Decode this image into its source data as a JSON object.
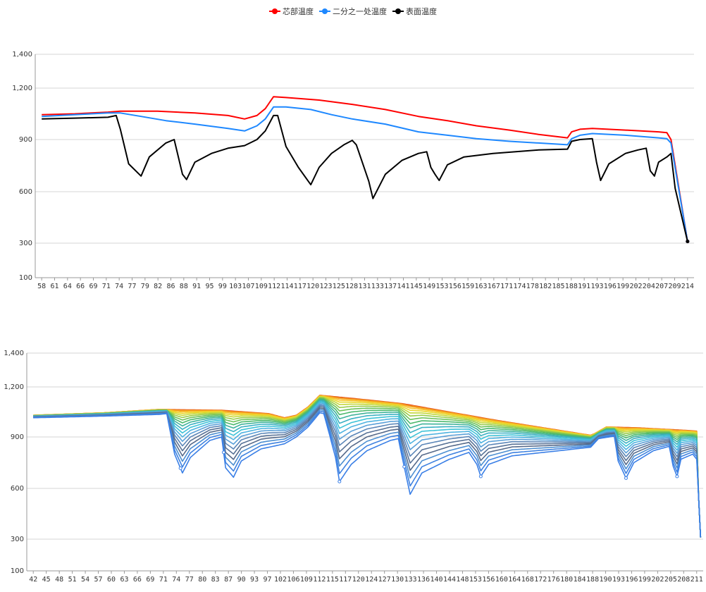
{
  "legend": [
    {
      "label": "芯部温度",
      "color": "#ff0000"
    },
    {
      "label": "二分之一处温度",
      "color": "#1e88ff"
    },
    {
      "label": "表面温度",
      "color": "#000000"
    }
  ],
  "chart_data": [
    {
      "type": "line",
      "title": "",
      "xlabel": "",
      "ylabel": "",
      "ylim": [
        100,
        1400
      ],
      "yticks": [
        100,
        300,
        600,
        900,
        1200,
        1400
      ],
      "ytick_labels": [
        "100",
        "300",
        "600",
        "900",
        "1,200",
        "1,400"
      ],
      "xticks": [
        "58",
        "61",
        "64",
        "66",
        "69",
        "71",
        "74",
        "77",
        "79",
        "82",
        "86",
        "88",
        "91",
        "95",
        "99",
        "103",
        "107",
        "109",
        "112",
        "114",
        "117",
        "120",
        "123",
        "125",
        "128",
        "131",
        "133",
        "137",
        "141",
        "145",
        "149",
        "153",
        "156",
        "159",
        "163",
        "167",
        "171",
        "174",
        "178",
        "182",
        "185",
        "188",
        "191",
        "193",
        "196",
        "199",
        "202",
        "204",
        "207",
        "209",
        "214"
      ],
      "grid": "horizontal",
      "legend_position": "top-center",
      "series": [
        {
          "name": "芯部温度",
          "color": "#ff0000",
          "points": [
            [
              58,
              1045
            ],
            [
              66,
              1050
            ],
            [
              74,
              1060
            ],
            [
              77,
              1065
            ],
            [
              86,
              1065
            ],
            [
              95,
              1055
            ],
            [
              103,
              1040
            ],
            [
              107,
              1020
            ],
            [
              110,
              1040
            ],
            [
              112,
              1080
            ],
            [
              114,
              1150
            ],
            [
              117,
              1145
            ],
            [
              125,
              1130
            ],
            [
              133,
              1105
            ],
            [
              141,
              1075
            ],
            [
              149,
              1035
            ],
            [
              156,
              1010
            ],
            [
              163,
              980
            ],
            [
              171,
              955
            ],
            [
              178,
              930
            ],
            [
              185,
              910
            ],
            [
              186,
              945
            ],
            [
              188,
              960
            ],
            [
              191,
              965
            ],
            [
              199,
              955
            ],
            [
              207,
              945
            ],
            [
              209,
              940
            ],
            [
              210,
              900
            ],
            [
              214,
              310
            ]
          ]
        },
        {
          "name": "二分之一处温度",
          "color": "#1e88ff",
          "points": [
            [
              58,
              1035
            ],
            [
              66,
              1045
            ],
            [
              74,
              1055
            ],
            [
              77,
              1055
            ],
            [
              82,
              1035
            ],
            [
              88,
              1010
            ],
            [
              95,
              990
            ],
            [
              103,
              965
            ],
            [
              107,
              950
            ],
            [
              110,
              980
            ],
            [
              112,
              1020
            ],
            [
              114,
              1090
            ],
            [
              117,
              1090
            ],
            [
              123,
              1075
            ],
            [
              128,
              1045
            ],
            [
              133,
              1020
            ],
            [
              141,
              990
            ],
            [
              149,
              945
            ],
            [
              156,
              925
            ],
            [
              163,
              905
            ],
            [
              171,
              890
            ],
            [
              178,
              880
            ],
            [
              185,
              870
            ],
            [
              186,
              905
            ],
            [
              188,
              925
            ],
            [
              191,
              935
            ],
            [
              199,
              925
            ],
            [
              207,
              910
            ],
            [
              209,
              905
            ],
            [
              210,
              880
            ],
            [
              214,
              310
            ]
          ]
        },
        {
          "name": "表面温度",
          "color": "#000000",
          "points": [
            [
              58,
              1020
            ],
            [
              66,
              1025
            ],
            [
              74,
              1030
            ],
            [
              76,
              1040
            ],
            [
              77,
              960
            ],
            [
              79,
              760
            ],
            [
              82,
              690
            ],
            [
              84,
              800
            ],
            [
              88,
              880
            ],
            [
              90,
              900
            ],
            [
              92,
              700
            ],
            [
              93,
              670
            ],
            [
              95,
              770
            ],
            [
              99,
              820
            ],
            [
              103,
              850
            ],
            [
              107,
              865
            ],
            [
              110,
              900
            ],
            [
              112,
              950
            ],
            [
              114,
              1040
            ],
            [
              115,
              1040
            ],
            [
              117,
              860
            ],
            [
              120,
              740
            ],
            [
              123,
              640
            ],
            [
              125,
              740
            ],
            [
              128,
              820
            ],
            [
              131,
              870
            ],
            [
              133,
              895
            ],
            [
              134,
              870
            ],
            [
              137,
              660
            ],
            [
              138,
              560
            ],
            [
              141,
              700
            ],
            [
              145,
              780
            ],
            [
              149,
              820
            ],
            [
              151,
              830
            ],
            [
              152,
              740
            ],
            [
              153,
              700
            ],
            [
              154,
              665
            ],
            [
              156,
              755
            ],
            [
              160,
              800
            ],
            [
              167,
              820
            ],
            [
              178,
              840
            ],
            [
              185,
              845
            ],
            [
              186,
              890
            ],
            [
              188,
              900
            ],
            [
              191,
              905
            ],
            [
              192,
              770
            ],
            [
              193,
              665
            ],
            [
              195,
              760
            ],
            [
              199,
              820
            ],
            [
              202,
              840
            ],
            [
              204,
              850
            ],
            [
              205,
              720
            ],
            [
              206,
              690
            ],
            [
              207,
              770
            ],
            [
              209,
              800
            ],
            [
              210,
              820
            ],
            [
              211,
              620
            ],
            [
              214,
              310
            ]
          ]
        }
      ]
    },
    {
      "type": "line",
      "title": "",
      "xlabel": "",
      "ylabel": "",
      "ylim": [
        100,
        1400
      ],
      "yticks": [
        100,
        300,
        600,
        900,
        1200,
        1400
      ],
      "ytick_labels": [
        "100",
        "300",
        "600",
        "900",
        "1,200",
        "1,400"
      ],
      "xticks": [
        "42",
        "45",
        "48",
        "51",
        "54",
        "57",
        "60",
        "63",
        "66",
        "69",
        "71",
        "74",
        "77",
        "80",
        "83",
        "87",
        "90",
        "93",
        "97",
        "102",
        "106",
        "109",
        "112",
        "115",
        "117",
        "120",
        "124",
        "127",
        "130",
        "133",
        "136",
        "140",
        "144",
        "148",
        "153",
        "156",
        "160",
        "164",
        "168",
        "172",
        "176",
        "180",
        "184",
        "188",
        "190",
        "193",
        "196",
        "199",
        "202",
        "205",
        "208",
        "211"
      ],
      "grid": "horizontal",
      "series_count": 20,
      "series_colors": [
        "#e34a1f",
        "#ef7a1a",
        "#f5a623",
        "#f7c52b",
        "#e8d82a",
        "#c4d83a",
        "#99cc4a",
        "#6ec25a",
        "#4bb96d",
        "#3fb39a",
        "#3ab0c3",
        "#3ec3d7",
        "#4fb3e0",
        "#5aa0d8",
        "#5b86b8",
        "#587296",
        "#566a8a",
        "#4d8fd1",
        "#3f82e0",
        "#3a7fe6"
      ],
      "envelope_top": [
        [
          42,
          1030
        ],
        [
          60,
          1045
        ],
        [
          74,
          1065
        ],
        [
          90,
          1060
        ],
        [
          102,
          1040
        ],
        [
          106,
          1015
        ],
        [
          109,
          1030
        ],
        [
          112,
          1080
        ],
        [
          115,
          1150
        ],
        [
          124,
          1130
        ],
        [
          136,
          1100
        ],
        [
          148,
          1050
        ],
        [
          160,
          1000
        ],
        [
          172,
          955
        ],
        [
          184,
          910
        ],
        [
          185,
          920
        ],
        [
          188,
          960
        ],
        [
          196,
          955
        ],
        [
          208,
          940
        ],
        [
          211,
          935
        ]
      ],
      "envelope_bottom": [
        [
          42,
          1015
        ],
        [
          60,
          1025
        ],
        [
          74,
          1035
        ],
        [
          76,
          1040
        ],
        [
          78,
          800
        ],
        [
          80,
          690
        ],
        [
          82,
          780
        ],
        [
          87,
          880
        ],
        [
          90,
          900
        ],
        [
          91,
          720
        ],
        [
          93,
          665
        ],
        [
          95,
          760
        ],
        [
          100,
          830
        ],
        [
          106,
          860
        ],
        [
          109,
          900
        ],
        [
          112,
          960
        ],
        [
          115,
          1045
        ],
        [
          116,
          1040
        ],
        [
          119,
          780
        ],
        [
          120,
          640
        ],
        [
          123,
          740
        ],
        [
          127,
          820
        ],
        [
          133,
          880
        ],
        [
          135,
          890
        ],
        [
          136,
          780
        ],
        [
          138,
          565
        ],
        [
          141,
          690
        ],
        [
          148,
          770
        ],
        [
          153,
          810
        ],
        [
          155,
          740
        ],
        [
          156,
          670
        ],
        [
          158,
          740
        ],
        [
          164,
          790
        ],
        [
          176,
          820
        ],
        [
          184,
          840
        ],
        [
          186,
          890
        ],
        [
          190,
          905
        ],
        [
          191,
          760
        ],
        [
          193,
          660
        ],
        [
          195,
          750
        ],
        [
          200,
          820
        ],
        [
          204,
          845
        ],
        [
          205,
          730
        ],
        [
          206,
          670
        ],
        [
          207,
          770
        ],
        [
          210,
          800
        ],
        [
          211,
          770
        ],
        [
          212,
          310
        ]
      ]
    }
  ]
}
